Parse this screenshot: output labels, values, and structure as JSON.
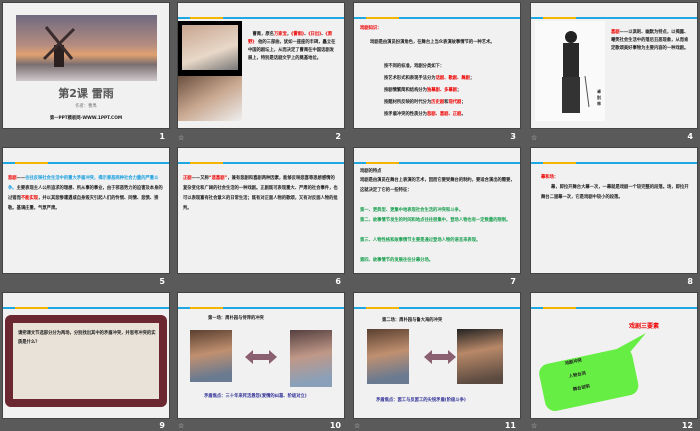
{
  "slides": [
    {
      "number": "1",
      "title": "第2课  雷雨",
      "author": "作者：曹禺",
      "site": "第一PPT模板网-WWW.1PPT.COM"
    },
    {
      "number": "2",
      "p1": "曹禺，原名",
      "name": "万家宝",
      "s1": "，",
      "w1": "《雷雨》",
      "s2": "、",
      "w2": "《日出》",
      "s3": "、",
      "w3": "《原野》",
      "p2": "他的三部曲，犹如一座座的丰碑，矗立在中国的剧坛上，从而决定了曹禺在中国话剧发展上，特别是话剧文学上的奠基地位。"
    },
    {
      "number": "3",
      "heading": "戏剧知识：",
      "intro": "戏剧是由演员扮演角色，在舞台上当众表演故事情节的一种艺术。",
      "lead": "按不同的标准，戏剧分类如下：",
      "l1a": "按艺术形式和表现手法分为",
      "l1b": "话剧、歌剧、舞剧",
      "l2a": "按剧情繁简和结构分为",
      "l2b": "独幕剧、多幕剧",
      "l3a": "按题材所反映的时代分为",
      "l3b": "历史剧",
      "l3c": "和",
      "l3d": "现代剧",
      "l4a": "按矛盾冲突的性质分为",
      "l4b": "悲剧、喜剧、正剧",
      "semi": "；",
      "end": "。"
    },
    {
      "number": "4",
      "term": "喜剧",
      "def": "——以讽刺、幽默为特点，以揭露、嘲笑社会生活中的落后丑恶现象，从而肯定歌颂美好事物为主要内容的一种戏剧。",
      "caption": "卓别林"
    },
    {
      "number": "5",
      "term": "悲剧",
      "dash": "——",
      "blue": "往往反映社会生活中的重大矛盾冲突，揭示善恶两种社会力量的严重斗争。",
      "a": "主要表现主人公所追求的理想、所从事的事业，由于邪恶势力的迫害及本身的过错而",
      "red": "不能实现",
      "b": "，并以其悲惨遭遇或自身毁灭引起人们的怜悯、同情、悲愤、崇敬。基调庄重，气氛严肃。"
    },
    {
      "number": "6",
      "term": "正剧",
      "a": "——又称",
      "red": "“悲喜剧”",
      "b": "，兼有悲剧和喜剧两种因素，能够反映悲喜等思想感情的复杂变化和广阔的社会生活的一种戏剧。正剧既可表现重大、严肃的社会事件，也可以表现富有社会意义的日常生活；既有对正面人物的歌颂，又有对反面人物的批判。"
    },
    {
      "number": "7",
      "heading": "戏剧的特点",
      "intro": "戏剧是由演员在舞台上表演的艺术，因而它要受舞台的制约，要适合演出的需要，这就决定了它的一些特征：",
      "f1": "第一、更典型、更集中地表现社会生活的冲突和斗争。",
      "f2": "第二、故事情节发生的时间和地点往往很集中，登场人物也有一定数量的限制。",
      "f3": "第三、人物性格和故事情节主要是通过登场人物的语言来表现。",
      "f4": "第四、故事情节的发展往往分幕分场。"
    },
    {
      "number": "8",
      "heading": "幕和场：",
      "body": "幕，即拉开舞台大幕一次，一幕就是戏剧一个较完整的段落。场，即拉开舞台二道幕一次，它是戏剧中较小的段落。"
    },
    {
      "number": "9",
      "question": "请把课文节选部分分为两场，分别找出其中的矛盾冲突，并思考冲突的实质是什么？"
    },
    {
      "number": "10",
      "heading": "第一场：周朴园与侍萍的冲突",
      "focus": "矛盾焦点：三十年来死活恩怨(爱情的纠葛、阶级对立)"
    },
    {
      "number": "11",
      "heading": "第二场：周朴园与鲁大海的冲突",
      "focus": "矛盾焦点：罢工与反罢工的尖锐矛盾(阶级斗争)"
    },
    {
      "number": "12",
      "heading": "戏剧三要素",
      "items": [
        "戏剧冲突",
        "人物台词",
        "舞台说明"
      ]
    }
  ],
  "colors": {
    "stripe": "#1ea7e1",
    "accent": "#f5b400",
    "red": "#e00000",
    "green_callout": "#66ee44"
  },
  "animation_icon": "transition-icon"
}
